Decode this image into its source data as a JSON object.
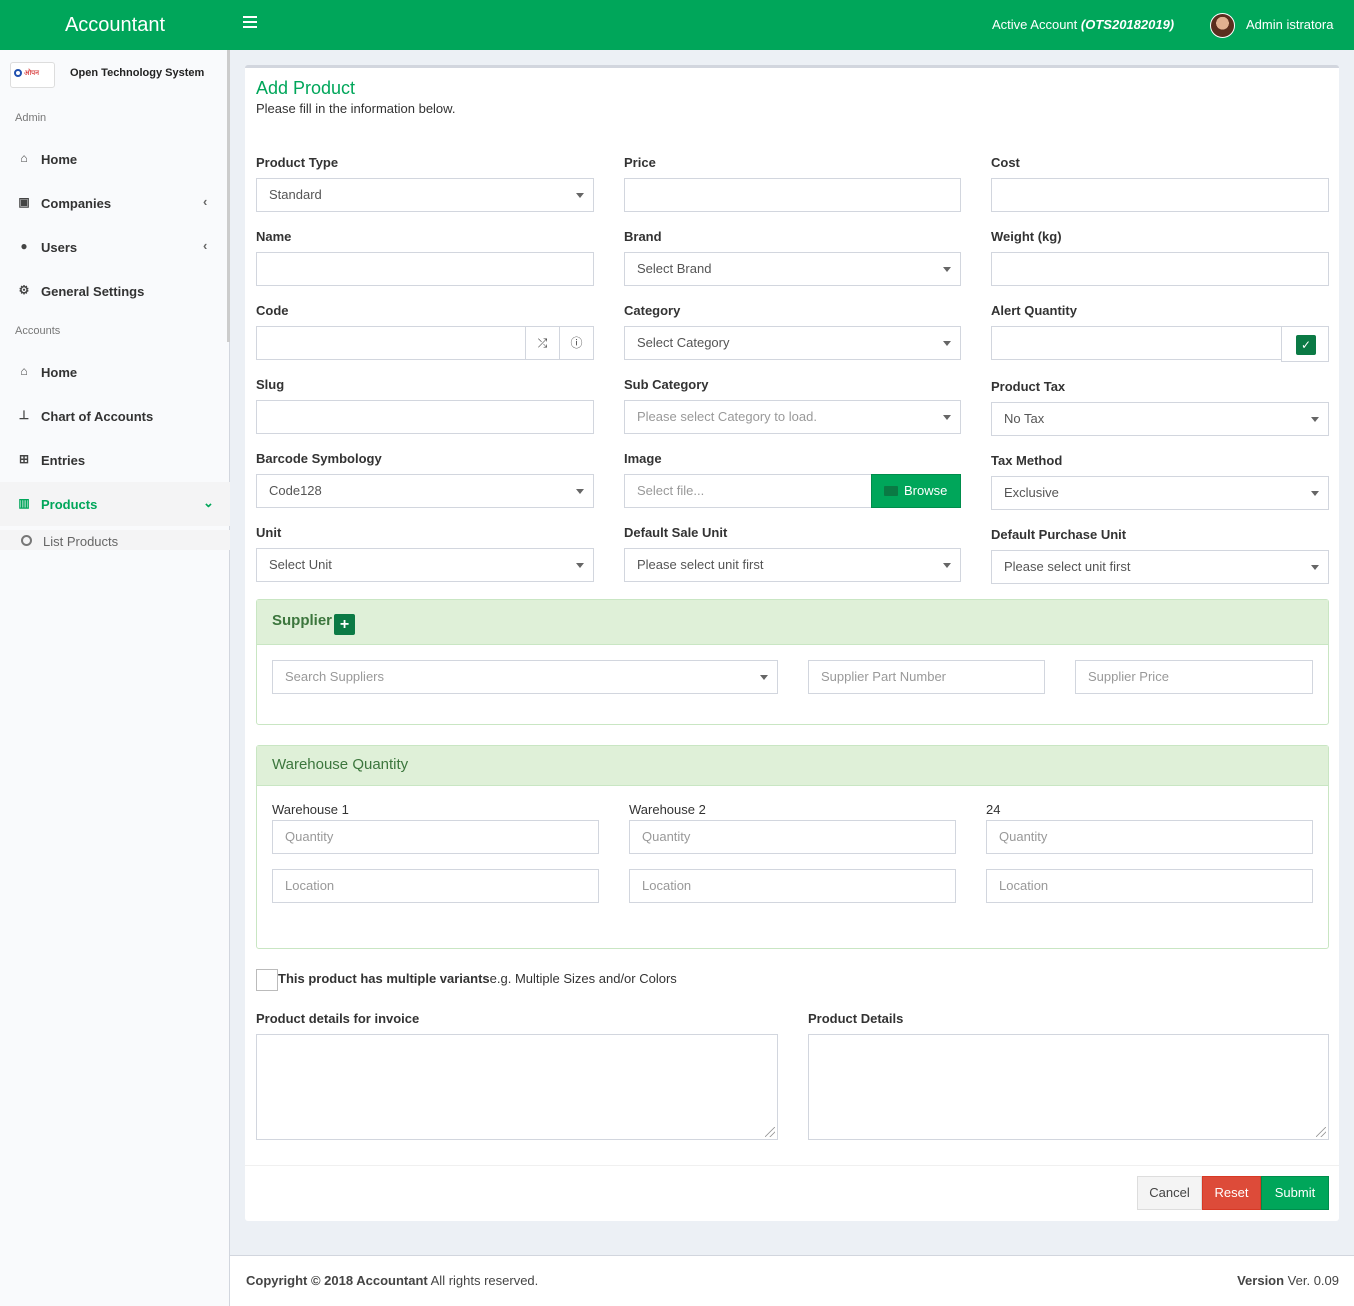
{
  "header": {
    "app_title": "Accountant",
    "active_account_label": "Active Account",
    "active_account_code": "(OTS20182019)",
    "user_name": "Admin istratora",
    "brand_color": "#00a65a"
  },
  "sidebar": {
    "org_name": "Open Technology System",
    "logo_text": "ओपन",
    "section_admin": "Admin",
    "section_accounts": "Accounts",
    "items": [
      {
        "label": "Home",
        "icon": "home-icon"
      },
      {
        "label": "Companies",
        "icon": "address-book-icon"
      },
      {
        "label": "Users",
        "icon": "users-icon"
      },
      {
        "label": "General Settings",
        "icon": "cogs-icon"
      },
      {
        "label": "Home",
        "icon": "home-icon"
      },
      {
        "label": "Chart of Accounts",
        "icon": "sitemap-icon"
      },
      {
        "label": "Entries",
        "icon": "plus-square-icon"
      },
      {
        "label": "Products",
        "icon": "barcode-icon"
      }
    ],
    "sub_items": [
      {
        "label": "List Products",
        "icon": "circle-icon"
      }
    ]
  },
  "page": {
    "title": "Add Product",
    "subtitle": "Please fill in the information below."
  },
  "form": {
    "product_type": {
      "label": "Product Type",
      "value": "Standard"
    },
    "price": {
      "label": "Price",
      "value": ""
    },
    "cost": {
      "label": "Cost",
      "value": ""
    },
    "name": {
      "label": "Name",
      "value": ""
    },
    "brand": {
      "label": "Brand",
      "value": "Select Brand"
    },
    "weight": {
      "label": "Weight (kg)",
      "value": ""
    },
    "code": {
      "label": "Code",
      "value": ""
    },
    "category": {
      "label": "Category",
      "value": "Select Category"
    },
    "alert_quantity": {
      "label": "Alert Quantity",
      "value": ""
    },
    "slug": {
      "label": "Slug",
      "value": ""
    },
    "sub_category": {
      "label": "Sub Category",
      "placeholder": "Please select Category to load."
    },
    "product_tax": {
      "label": "Product Tax",
      "value": "No Tax"
    },
    "barcode_symbology": {
      "label": "Barcode Symbology",
      "value": "Code128"
    },
    "image": {
      "label": "Image",
      "placeholder": "Select file...",
      "browse_label": "Browse"
    },
    "tax_method": {
      "label": "Tax Method",
      "value": "Exclusive"
    },
    "unit": {
      "label": "Unit",
      "value": "Select Unit"
    },
    "default_sale_unit": {
      "label": "Default Sale Unit",
      "value": "Please select unit first"
    },
    "default_purchase_unit": {
      "label": "Default Purchase Unit",
      "value": "Please select unit first"
    }
  },
  "supplier": {
    "title": "Supplier",
    "search_placeholder": "Search Suppliers",
    "part_number_placeholder": "Supplier Part Number",
    "price_placeholder": "Supplier Price"
  },
  "warehouse": {
    "title": "Warehouse Quantity",
    "warehouses": [
      {
        "name": "Warehouse 1",
        "quantity_placeholder": "Quantity",
        "location_placeholder": "Location"
      },
      {
        "name": "Warehouse 2",
        "quantity_placeholder": "Quantity",
        "location_placeholder": "Location"
      },
      {
        "name": "24",
        "quantity_placeholder": "Quantity",
        "location_placeholder": "Location"
      }
    ]
  },
  "variants": {
    "label_bold": "This product has multiple variants",
    "hint": "e.g. Multiple Sizes and/or Colors"
  },
  "details": {
    "invoice_label": "Product details for invoice",
    "details_label": "Product Details"
  },
  "actions": {
    "cancel": "Cancel",
    "reset": "Reset",
    "submit": "Submit",
    "reset_color": "#dd4b39",
    "submit_color": "#00a65a"
  },
  "footer": {
    "copyright_bold": "Copyright © 2018 Accountant",
    "copyright_rest": " All rights reserved.",
    "version_label": "Version",
    "version_value": " Ver. 0.09"
  }
}
